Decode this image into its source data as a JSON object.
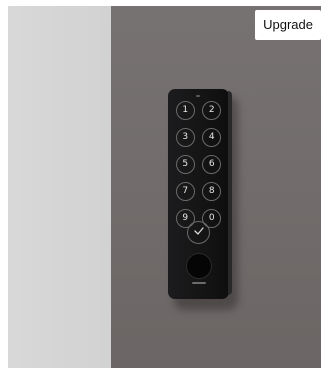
{
  "header": {
    "upgrade_label": "Upgrade"
  },
  "keypad": {
    "keys": [
      "1",
      "2",
      "3",
      "4",
      "5",
      "6",
      "7",
      "8",
      "9",
      "0"
    ],
    "confirm_icon": "checkmark-icon",
    "fingerprint_icon": "fingerprint-sensor-icon"
  },
  "colors": {
    "wall_left": "#d8d8d8",
    "wall_right": "#757070",
    "keypad_body": "#161617"
  }
}
